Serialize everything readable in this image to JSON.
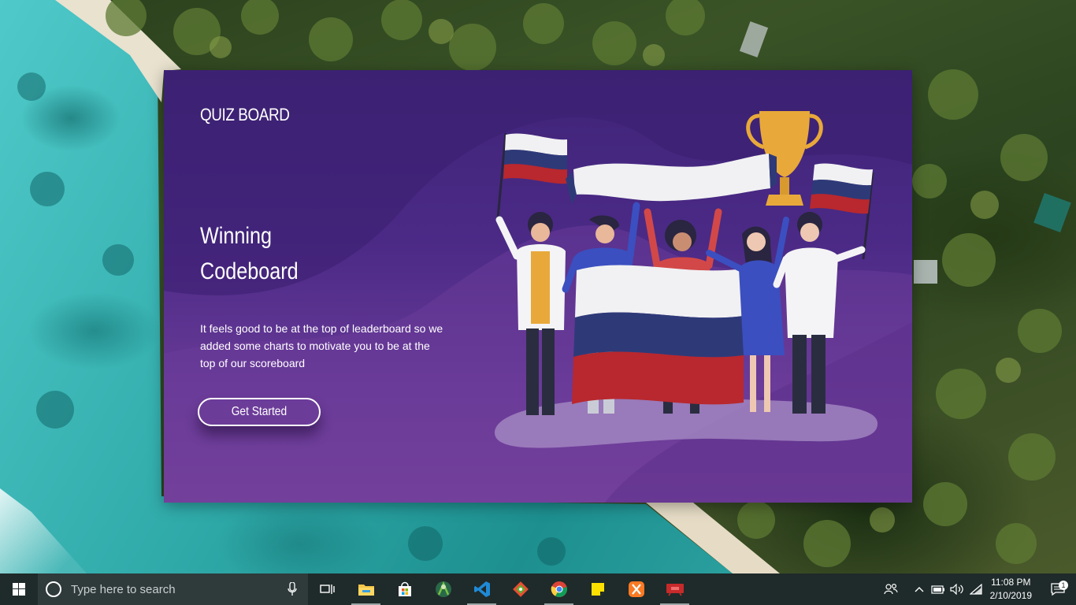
{
  "app": {
    "brand": "QUIZ BOARD",
    "headline": [
      "Winning",
      "Codeboard"
    ],
    "description": "It feels good to be at the top of leaderboard so we added some charts to motivate you to be at the top of our scoreboard",
    "cta_label": "Get Started",
    "colors": {
      "card_top": "#3f2478",
      "card_bottom": "#7a459c",
      "flag_red": "#b8282e",
      "flag_blue": "#2e3a78",
      "trophy": "#e8a93a"
    },
    "illustration": "fans-celebrating-with-flags-and-trophy"
  },
  "taskbar": {
    "start_icon": "windows-logo-icon",
    "search_placeholder": "Type here to search",
    "apps": [
      {
        "name": "task-view-icon"
      },
      {
        "name": "file-explorer-icon"
      },
      {
        "name": "microsoft-store-icon"
      },
      {
        "name": "android-studio-icon"
      },
      {
        "name": "visual-studio-code-icon"
      },
      {
        "name": "git-icon"
      },
      {
        "name": "chrome-icon"
      },
      {
        "name": "sticky-notes-icon"
      },
      {
        "name": "xampp-icon"
      },
      {
        "name": "presentation-app-icon"
      }
    ],
    "tray": {
      "time": "11:08 PM",
      "date": "2/10/2019",
      "notification_count": "1"
    }
  }
}
